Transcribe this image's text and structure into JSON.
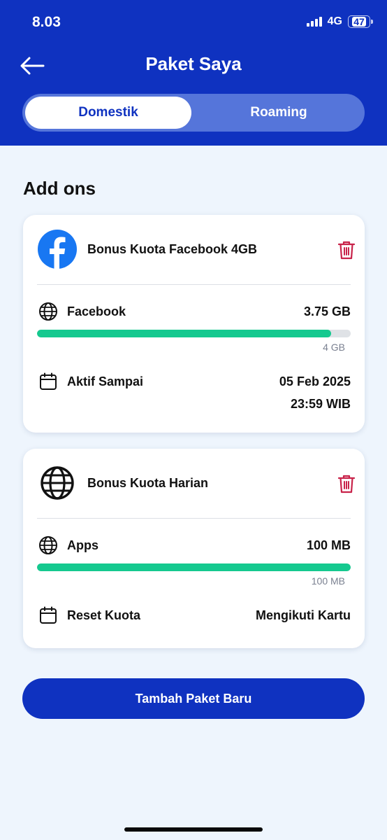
{
  "status_bar": {
    "time": "8.03",
    "network": "4G",
    "battery": "47"
  },
  "header": {
    "title": "Paket Saya",
    "tabs": [
      {
        "label": "Domestik",
        "active": true
      },
      {
        "label": "Roaming",
        "active": false
      }
    ]
  },
  "section": {
    "title": "Add ons"
  },
  "packages": [
    {
      "name": "Bonus Kuota Facebook 4GB",
      "logo_icon": "facebook-icon",
      "usage_label": "Facebook",
      "usage_value": "3.75 GB",
      "usage_total": "4 GB",
      "usage_fraction": 0.9375,
      "info_label": "Aktif Sampai",
      "info_value_line1": "05 Feb 2025",
      "info_value_line2": "23:59 WIB"
    },
    {
      "name": "Bonus Kuota Harian",
      "logo_icon": "globe-icon",
      "usage_label": "Apps",
      "usage_value": "100 MB",
      "usage_total": "100 MB",
      "usage_fraction": 1.0,
      "info_label": "Reset Kuota",
      "info_value": "Mengikuti Kartu"
    }
  ],
  "actions": {
    "add_package": "Tambah Paket Baru"
  },
  "colors": {
    "brand": "#0f32c0",
    "progress": "#15c98f",
    "delete": "#c8234a"
  }
}
